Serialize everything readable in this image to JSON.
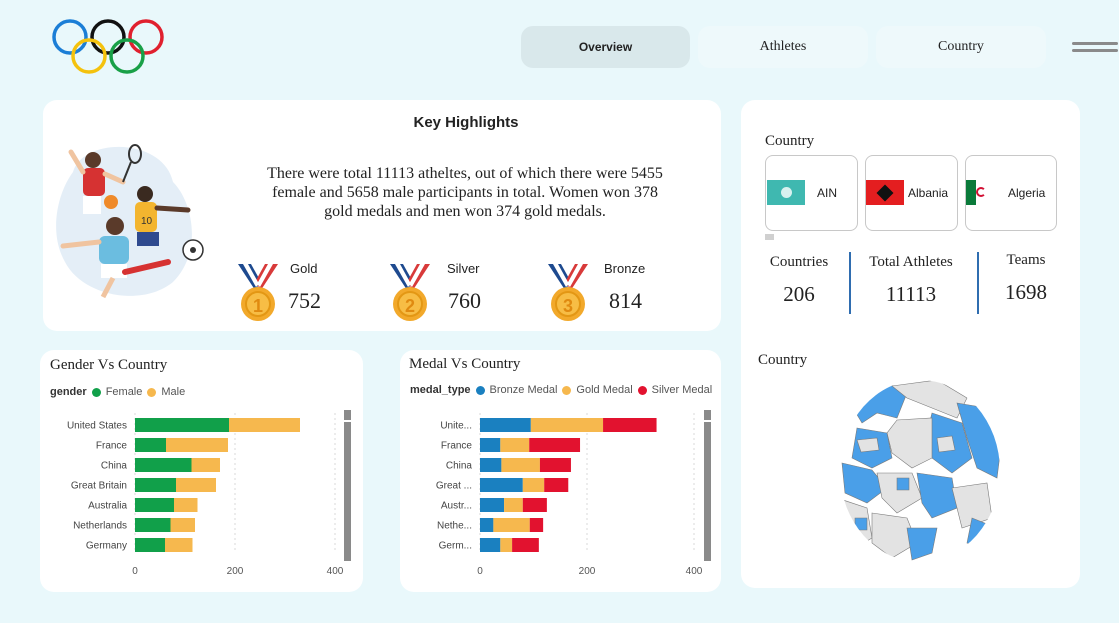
{
  "nav": {
    "tabs": [
      {
        "label": "Overview",
        "active": true
      },
      {
        "label": "Athletes",
        "active": false
      },
      {
        "label": "Country",
        "active": false
      }
    ]
  },
  "highlights": {
    "title": "Key Highlights",
    "summary": "There were total 11113 atheltes, out of which there were 5455 female and 5658 male participants in total. Women won 378 gold medals and men won 374 gold medals.",
    "medals": [
      {
        "label": "Gold",
        "value": "752",
        "number": "1"
      },
      {
        "label": "Silver",
        "value": "760",
        "number": "2"
      },
      {
        "label": "Bronze",
        "value": "814",
        "number": "3"
      }
    ]
  },
  "country_panel": {
    "title": "Country",
    "tiles": [
      {
        "name": "AIN",
        "flag_icon": "ain-flag-icon"
      },
      {
        "name": "Albania",
        "flag_icon": "albania-flag-icon"
      },
      {
        "name": "Algeria",
        "flag_icon": "algeria-flag-icon"
      }
    ],
    "kpis": [
      {
        "label": "Countries",
        "value": "206"
      },
      {
        "label": "Total Athletes",
        "value": "11113"
      },
      {
        "label": "Teams",
        "value": "1698"
      }
    ],
    "map_title": "Country"
  },
  "colors": {
    "female": "#11a04a",
    "male": "#f6b84e",
    "bronze": "#1a80c0",
    "gold": "#f6b84e",
    "silver": "#e2122f",
    "kpi_separator": "#2f6db0",
    "map_land_highlight": "#4a9fe8",
    "map_land_other": "#e3e3e3"
  },
  "chart_data": [
    {
      "type": "bar",
      "orientation": "horizontal",
      "stacked": true,
      "title": "Gender Vs Country",
      "legend_title": "gender",
      "categories": [
        "United States",
        "France",
        "China",
        "Great Britain",
        "Australia",
        "Netherlands",
        "Germany"
      ],
      "series": [
        {
          "name": "Female",
          "values": [
            188,
            62,
            113,
            82,
            78,
            71,
            60
          ]
        },
        {
          "name": "Male",
          "values": [
            142,
            124,
            57,
            80,
            47,
            49,
            55
          ]
        }
      ],
      "xticks": [
        "0",
        "200",
        "400"
      ],
      "xlim": [
        0,
        400
      ],
      "grid": true,
      "legend_position": "top-left"
    },
    {
      "type": "bar",
      "orientation": "horizontal",
      "stacked": true,
      "title": "Medal Vs Country",
      "legend_title": "medal_type",
      "categories": [
        "Unite...",
        "France",
        "China",
        "Great ...",
        "Austr...",
        "Nethe...",
        "Germ..."
      ],
      "series": [
        {
          "name": "Bronze Medal",
          "values": [
            95,
            38,
            40,
            80,
            45,
            25,
            38
          ]
        },
        {
          "name": "Gold Medal",
          "values": [
            135,
            54,
            72,
            40,
            35,
            68,
            22
          ]
        },
        {
          "name": "Silver Medal",
          "values": [
            100,
            95,
            58,
            45,
            45,
            25,
            50
          ]
        }
      ],
      "xticks": [
        "0",
        "200",
        "400"
      ],
      "xlim": [
        0,
        400
      ],
      "grid": true,
      "legend_position": "top-left"
    }
  ]
}
